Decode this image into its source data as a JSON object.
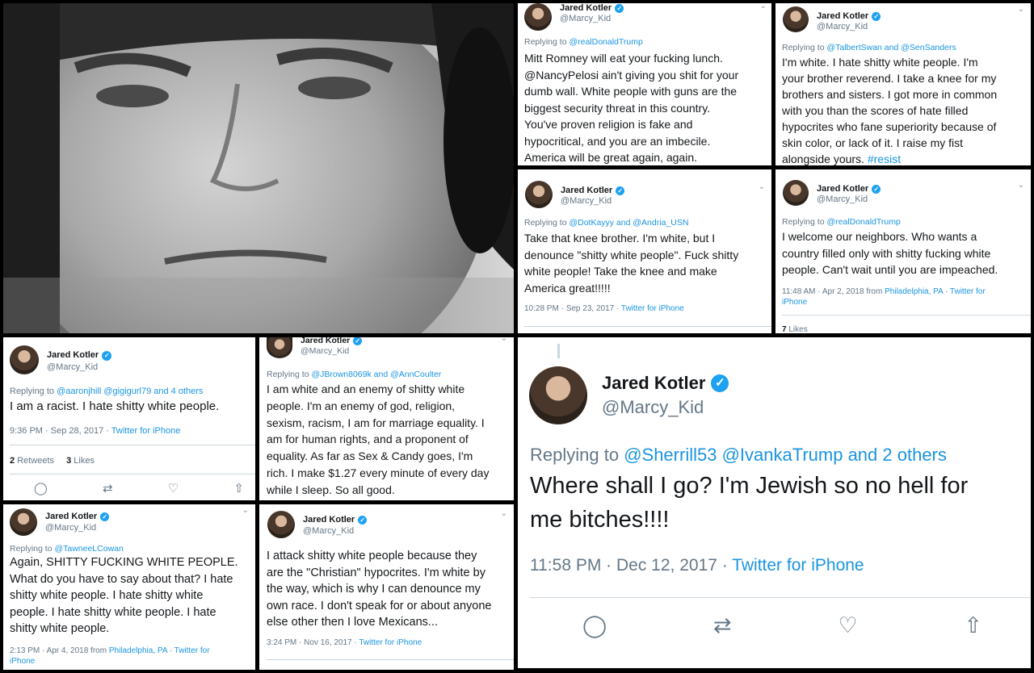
{
  "colors": {
    "link": "#1b95e0",
    "verified": "#1da1f2",
    "grey": "#657786"
  },
  "icons": {
    "verified": "verified-badge-icon",
    "reply": "reply-icon",
    "retweet": "retweet-icon",
    "like": "like-icon",
    "share": "share-icon",
    "chevron": "chevron-down-icon"
  },
  "user": {
    "name": "Jared Kotler",
    "handle": "@Marcy_Kid"
  },
  "tweets": [
    {
      "reply_prefix": "Replying to ",
      "reply_to": "@realDonaldTrump",
      "lines": [
        "Mitt Romney will eat your fucking lunch.",
        "@NancyPelosi ain't giving you shit for your",
        "dumb wall. White people with guns are the",
        "biggest security threat in this country.",
        "You've proven religion is fake and",
        "hypocritical, and you are an imbecile.",
        "America will be great again, again."
      ]
    },
    {
      "reply_prefix": "Replying to ",
      "reply_to": "@TalbertSwan and @SenSanders",
      "lines": [
        "I'm white. I hate shitty white people. I'm",
        "your brother reverend. I take a knee for my",
        "brothers and sisters. I got more in common",
        "with you than the scores of hate filled",
        "hypocrites who fane superiority because of",
        "skin color, or lack of it. I raise my fist"
      ],
      "last_line": "alongside yours. ",
      "hashtag": "#resist"
    },
    {
      "reply_prefix": "Replying to ",
      "reply_to": "@DotKayyy and @Andria_USN",
      "lines": [
        "Take that knee brother. I'm white, but I",
        "denounce \"shitty white people\". Fuck shitty",
        "white people! Take the knee and make",
        "America great!!!!!"
      ],
      "meta_time": "10:28 PM · Sep 23, 2017 · ",
      "meta_source": "Twitter for iPhone"
    },
    {
      "reply_prefix": "Replying to ",
      "reply_to": "@realDonaldTrump",
      "lines": [
        "I welcome our neighbors. Who wants a",
        "country filled only with shitty fucking white",
        "people. Can't wait until you are impeached."
      ],
      "meta_time": "11:48 AM · Apr 2, 2018 from ",
      "meta_place": "Philadelphia, PA",
      "meta_sep": " · ",
      "meta_source": "Twitter for",
      "meta_source2": "iPhone",
      "likes_count": "7",
      "likes_label": "Likes"
    },
    {
      "reply_prefix": "Replying to ",
      "reply_to": "@aaronjhill @gigigurl79 and 4 others",
      "lines": [
        "I am a racist. I hate shitty white people."
      ],
      "meta_time": "9:36 PM · Sep 28, 2017 · ",
      "meta_source": "Twitter for iPhone",
      "retweets_count": "2",
      "retweets_label": "Retweets",
      "likes_count": "3",
      "likes_label": "Likes"
    },
    {
      "reply_prefix": "Replying to ",
      "reply_to": "@JBrown8069k and @AnnCoulter",
      "lines": [
        "I am white and an enemy of shitty white",
        "people. I'm an enemy of god, religion,",
        "sexism, racism, I am for marriage equality. I",
        "am for human rights, and a proponent of",
        "equality. As far as Sex & Candy goes, I'm",
        "rich. I make $1.27 every minute of every day",
        "while I sleep. So all good."
      ]
    },
    {
      "reply_prefix": "Replying to ",
      "reply_to": "@Sherrill53 @IvankaTrump and 2 others",
      "lines": [
        "Where shall I go? I'm Jewish so no hell for",
        "me bitches!!!!"
      ],
      "meta_time": "11:58 PM · Dec 12, 2017 · ",
      "meta_source": "Twitter for iPhone"
    },
    {
      "reply_prefix": "Replying to ",
      "reply_to": "@TawneeLCowan",
      "lines": [
        "Again, SHITTY FUCKING WHITE PEOPLE.",
        "What do you have to say about that? I hate",
        "shitty white people. I hate shitty white",
        "people. I hate shitty white people. I hate",
        "shitty white people."
      ],
      "meta_time": "2:13 PM · Apr 4, 2018 from ",
      "meta_place": "Philadelphia, PA",
      "meta_sep": " · ",
      "meta_source": "Twitter for",
      "meta_source2": "iPhone"
    },
    {
      "lines": [
        "I attack shitty white people because they",
        "are the \"Christian\" hypocrites. I'm white by",
        "the way, which is why I can denounce my",
        "own race. I don't speak for or about anyone",
        "else other then I love Mexicans..."
      ],
      "meta_time": "3:24 PM · Nov 16, 2017 · ",
      "meta_source": "Twitter for iPhone"
    }
  ]
}
